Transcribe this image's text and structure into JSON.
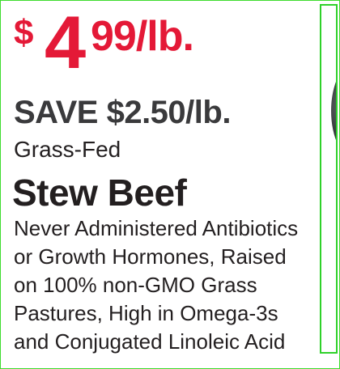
{
  "price": {
    "dollar_sign": "$",
    "whole": "4",
    "cents_unit": "99/lb."
  },
  "savings": "SAVE $2.50/lb.",
  "descriptor": "Grass-Fed",
  "product_name": "Stew Beef",
  "details_lines": [
    "Never Administered Antibiotics",
    "or Growth Hormones, Raised",
    "on 100% non-GMO Grass",
    "Pastures, High in Omega-3s",
    "and Conjugated Linoleic Acid"
  ],
  "colors": {
    "price_red": "#e41937",
    "frame_green": "#3ddc2e"
  },
  "icons": {
    "product_photo": "beef-photo-partial"
  }
}
